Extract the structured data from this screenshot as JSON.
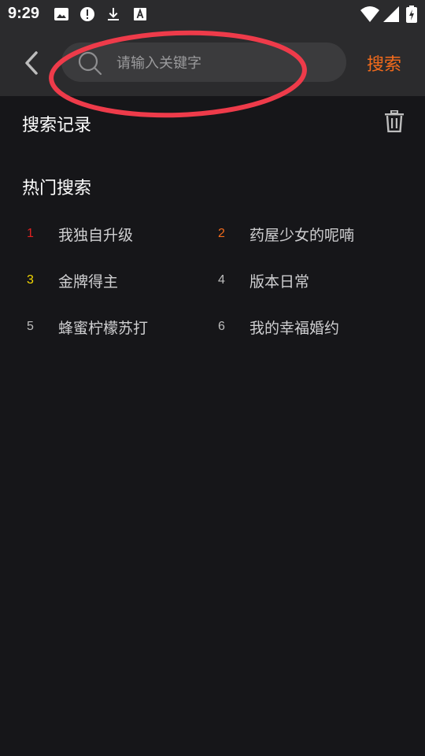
{
  "status_bar": {
    "time": "9:29",
    "left_icons": [
      "image-icon",
      "alert-icon",
      "download-icon",
      "font-icon"
    ],
    "right_icons": [
      "wifi-icon",
      "signal-icon",
      "battery-icon"
    ]
  },
  "search": {
    "placeholder": "请输入关键字",
    "submit_label": "搜索",
    "accent_color": "#f36b1c"
  },
  "history": {
    "title": "搜索记录"
  },
  "hot": {
    "title": "热门搜索",
    "items": [
      {
        "rank": "1",
        "name": "我独自升级",
        "rank_color": "#e02020"
      },
      {
        "rank": "2",
        "name": "药屋少女的呢喃",
        "rank_color": "#f36b1c"
      },
      {
        "rank": "3",
        "name": "金牌得主",
        "rank_color": "#f5d800"
      },
      {
        "rank": "4",
        "name": "版本日常",
        "rank_color": "#bdbdbd"
      },
      {
        "rank": "5",
        "name": "蜂蜜柠檬苏打",
        "rank_color": "#bdbdbd"
      },
      {
        "rank": "6",
        "name": "我的幸福婚约",
        "rank_color": "#bdbdbd"
      }
    ]
  },
  "annotation_color": "#ee3b4a"
}
